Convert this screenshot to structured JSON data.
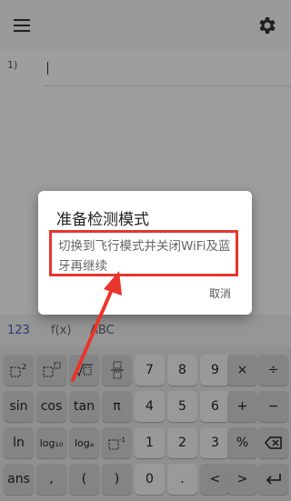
{
  "editor": {
    "line_number": "1)"
  },
  "keyboard_tabs": [
    {
      "label": "123"
    },
    {
      "label": "f(x)"
    },
    {
      "label": "ABC"
    }
  ],
  "keys": {
    "r1": [
      "7",
      "8",
      "9",
      "×",
      "÷"
    ],
    "r2": [
      "sin",
      "cos",
      "tan",
      "π",
      "4",
      "5",
      "6",
      "+",
      "−"
    ],
    "r3": [
      "ln",
      "log₁₀",
      "logₐ",
      "1",
      "2",
      "3",
      "%"
    ],
    "r4": [
      "ans",
      ",",
      "(",
      ")",
      "0",
      ".",
      "<",
      ">"
    ]
  },
  "dialog": {
    "title": "准备检测模式",
    "message": "切换到飞行模式并关闭WiFi及蓝牙再继续",
    "cancel": "取消"
  },
  "colors": {
    "highlight": "#e8352c",
    "accent": "#4a5acb"
  },
  "icons": [
    "menu-icon",
    "gear-icon",
    "backspace-icon",
    "enter-icon"
  ]
}
